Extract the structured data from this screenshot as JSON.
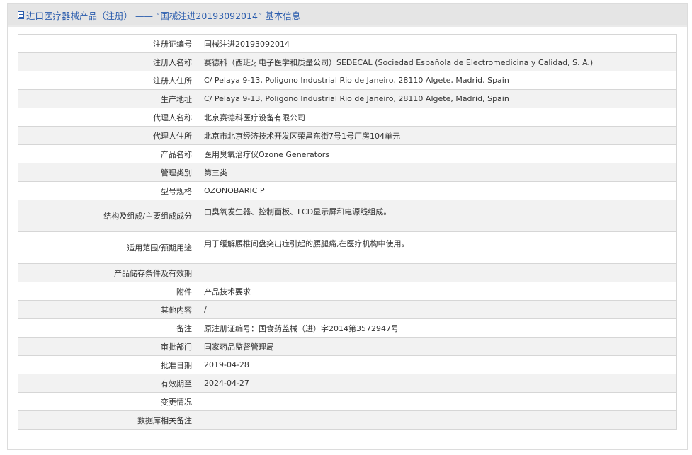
{
  "header": {
    "title": "进口医疗器械产品（注册） ——  “国械注进20193092014”  基本信息"
  },
  "rows": [
    {
      "label": "注册证编号",
      "value": "国械注进20193092014",
      "tall": false
    },
    {
      "label": "注册人名称",
      "value": "赛德科（西班牙电子医学和质量公司）SEDECAL (Sociedad Española de Electromedicina y Calidad, S. A.)",
      "tall": false
    },
    {
      "label": "注册人住所",
      "value": "C/ Pelaya 9-13, Poligono Industrial Rio de Janeiro, 28110 Algete, Madrid, Spain",
      "tall": false
    },
    {
      "label": "生产地址",
      "value": "C/ Pelaya 9-13, Poligono Industrial Rio de Janeiro, 28110 Algete, Madrid, Spain",
      "tall": false
    },
    {
      "label": "代理人名称",
      "value": "北京赛德科医疗设备有限公司",
      "tall": false
    },
    {
      "label": "代理人住所",
      "value": "北京市北京经济技术开发区荣昌东街7号1号厂房104单元",
      "tall": false
    },
    {
      "label": "产品名称",
      "value": "医用臭氧治疗仪Ozone Generators",
      "tall": false
    },
    {
      "label": "管理类别",
      "value": "第三类",
      "tall": false
    },
    {
      "label": "型号规格",
      "value": "OZONOBARIC P",
      "tall": false
    },
    {
      "label": "结构及组成/主要组成成分",
      "value": "由臭氧发生器、控制面板、LCD显示屏和电源线组成。",
      "tall": true
    },
    {
      "label": "适用范围/预期用途",
      "value": "用于缓解腰椎间盘突出症引起的腰腿痛,在医疗机构中使用。",
      "tall": true
    },
    {
      "label": "产品储存条件及有效期",
      "value": "",
      "tall": false
    },
    {
      "label": "附件",
      "value": "产品技术要求",
      "tall": false
    },
    {
      "label": "其他内容",
      "value": "/",
      "tall": false
    },
    {
      "label": "备注",
      "value": "原注册证编号：国食药监械（进）字2014第3572947号",
      "tall": false
    },
    {
      "label": "审批部门",
      "value": "国家药品监督管理局",
      "tall": false
    },
    {
      "label": "批准日期",
      "value": "2019-04-28",
      "tall": false
    },
    {
      "label": "有效期至",
      "value": "2024-04-27",
      "tall": false
    },
    {
      "label": "变更情况",
      "value": "",
      "tall": false
    },
    {
      "label": "数据库相关备注",
      "value": "",
      "tall": false
    }
  ],
  "colors": {
    "title": "#2a5cad",
    "alt_row": "#f2f2f2",
    "border": "#d6d6d6"
  },
  "icons": {
    "title_icon": "document-icon"
  }
}
